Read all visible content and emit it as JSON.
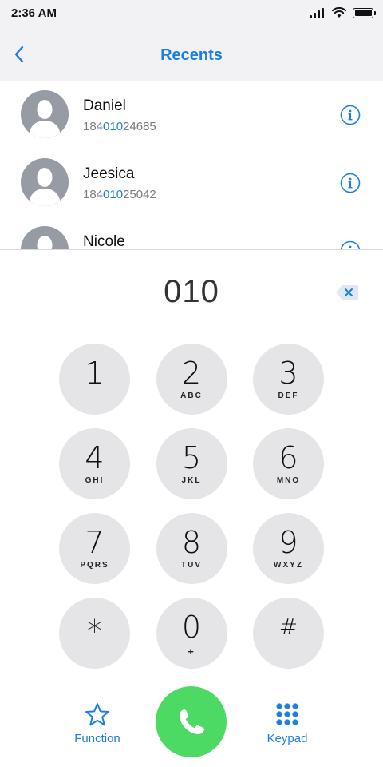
{
  "status_bar": {
    "time": "2:36 AM"
  },
  "nav": {
    "title": "Recents"
  },
  "recents": [
    {
      "name": "Daniel",
      "number_prefix": "184",
      "number_match": "010",
      "number_suffix": "24685"
    },
    {
      "name": "Jeesica",
      "number_prefix": "184",
      "number_match": "010",
      "number_suffix": "25042"
    },
    {
      "name": "Nicole",
      "number_prefix": "",
      "number_match": "",
      "number_suffix": ""
    }
  ],
  "dialer": {
    "display": "010"
  },
  "keypad": {
    "keys": [
      {
        "digit": "1",
        "letters": ""
      },
      {
        "digit": "2",
        "letters": "ABC"
      },
      {
        "digit": "3",
        "letters": "DEF"
      },
      {
        "digit": "4",
        "letters": "GHI"
      },
      {
        "digit": "5",
        "letters": "JKL"
      },
      {
        "digit": "6",
        "letters": "MNO"
      },
      {
        "digit": "7",
        "letters": "PQRS"
      },
      {
        "digit": "8",
        "letters": "TUV"
      },
      {
        "digit": "9",
        "letters": "WXYZ"
      },
      {
        "digit": "*",
        "letters": ""
      },
      {
        "digit": "0",
        "letters": "+"
      },
      {
        "digit": "#",
        "letters": ""
      }
    ]
  },
  "bottom_bar": {
    "function_label": "Function",
    "keypad_label": "Keypad",
    "function_icon": "star-icon",
    "keypad_icon": "keypad-grid-icon",
    "call_icon": "phone-icon"
  },
  "colors": {
    "accent": "#1d7fe0",
    "call_green": "#4cd964",
    "key_background": "#e5e5e7"
  }
}
